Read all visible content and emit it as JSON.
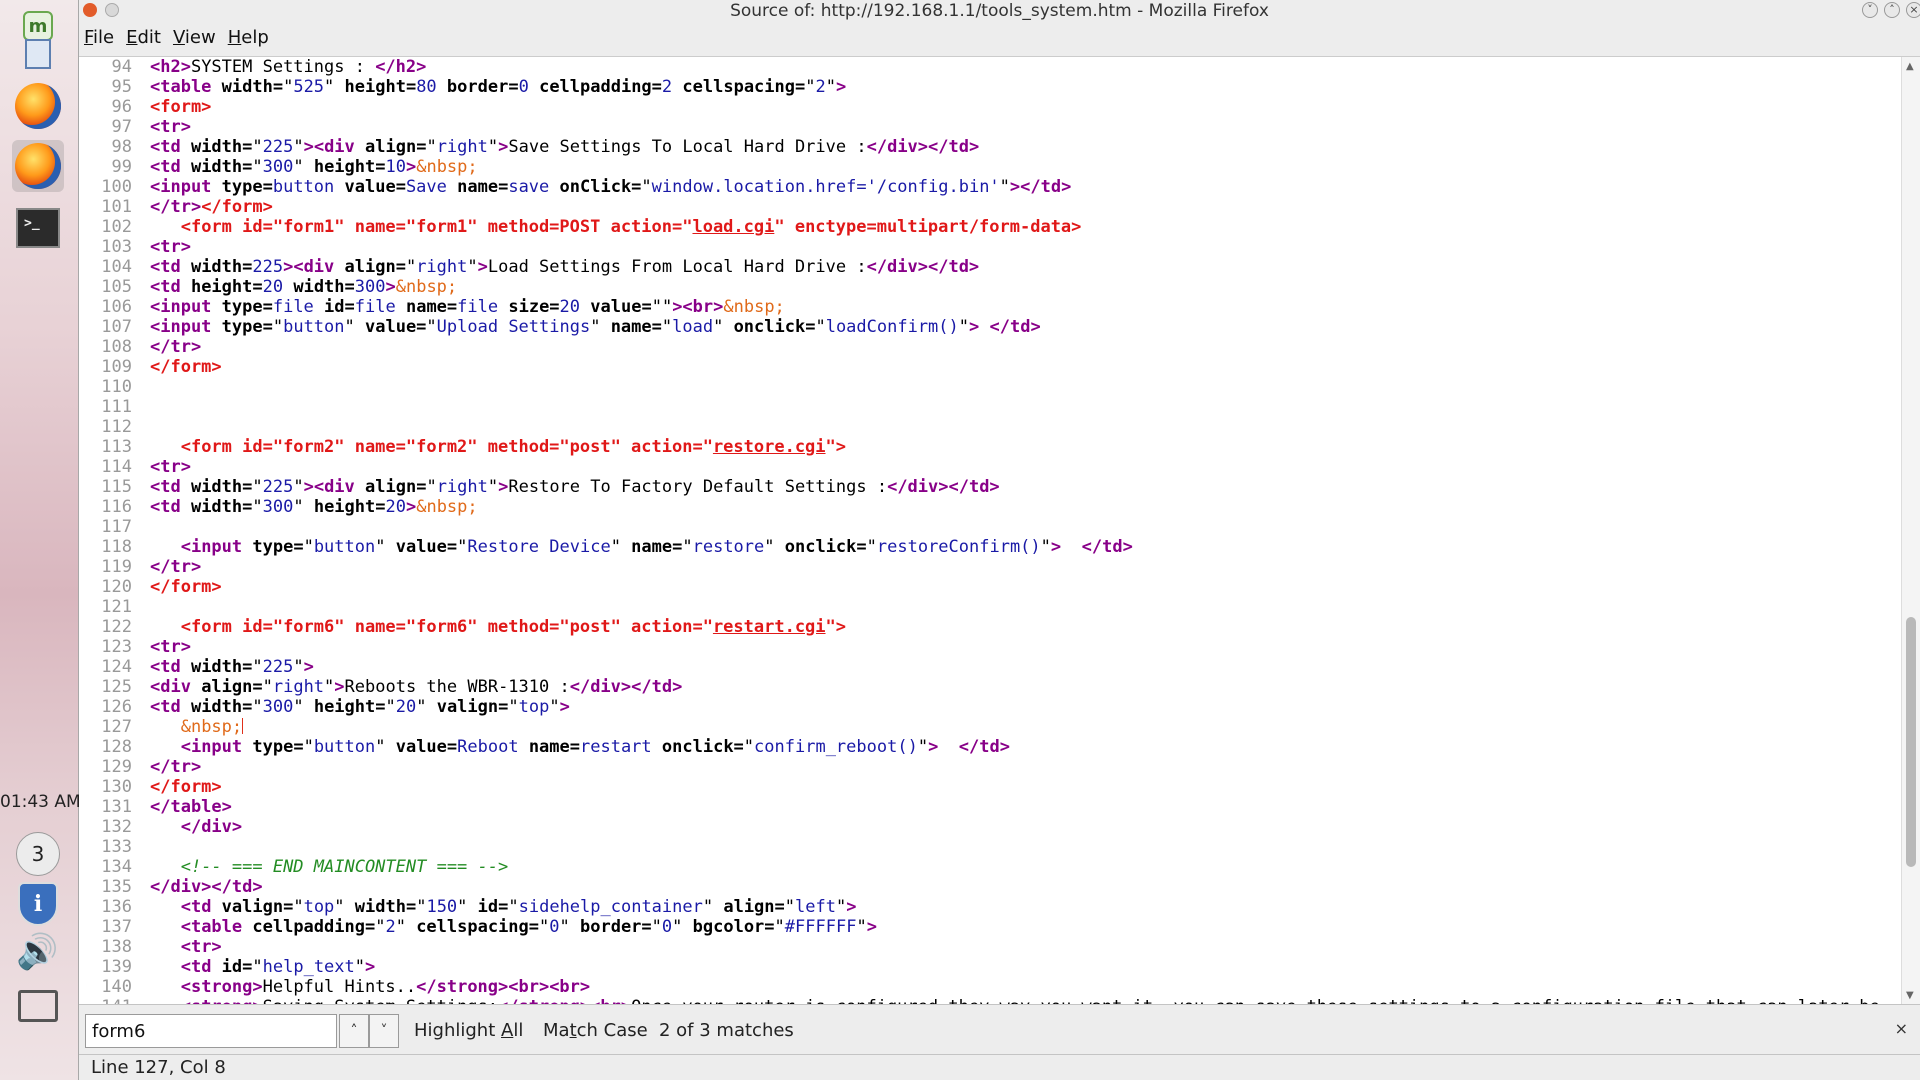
{
  "window": {
    "title": "Source of: http://192.168.1.1/tools_system.htm - Mozilla Firefox"
  },
  "menubar": {
    "items": [
      {
        "label": "File",
        "mnemonic": "F",
        "rest": "ile"
      },
      {
        "label": "Edit",
        "mnemonic": "E",
        "rest": "dit"
      },
      {
        "label": "View",
        "mnemonic": "V",
        "rest": "iew"
      },
      {
        "label": "Help",
        "mnemonic": "H",
        "rest": "elp"
      }
    ]
  },
  "dock": {
    "clock": "01:43 AM",
    "workspace": "3",
    "icons": [
      "mint-menu-icon",
      "file-manager-icon",
      "firefox-icon",
      "firefox-active-icon",
      "terminal-icon",
      "workspace-switcher",
      "update-manager-shield-icon",
      "volume-icon",
      "network-icon"
    ]
  },
  "source": {
    "lines": [
      {
        "n": "94",
        "html": "<span class=\"tag\">&lt;h2&gt;</span>SYSTEM Settings : <span class=\"tag\">&lt;/h2&gt;</span>"
      },
      {
        "n": "95",
        "html": "<span class=\"tag\">&lt;table </span><span class=\"attr\">width=</span>\"<span class=\"val\">525</span>\" <span class=\"attr\">height=</span><span class=\"val\">80</span> <span class=\"attr\">border=</span><span class=\"val\">0</span> <span class=\"attr\">cellpadding=</span><span class=\"val\">2</span> <span class=\"attr\">cellspacing=</span>\"<span class=\"val\">2</span>\"<span class=\"tag\">&gt;</span>"
      },
      {
        "n": "96",
        "html": "<span class=\"form\">&lt;form&gt;</span>"
      },
      {
        "n": "97",
        "html": "<span class=\"tag\">&lt;tr&gt;</span>"
      },
      {
        "n": "98",
        "html": "<span class=\"tag\">&lt;td </span><span class=\"attr\">width=</span>\"<span class=\"val\">225</span>\"<span class=\"tag\">&gt;&lt;div </span><span class=\"attr\">align=</span>\"<span class=\"val\">right</span>\"<span class=\"tag\">&gt;</span>Save Settings To Local Hard Drive :<span class=\"tag\">&lt;/div&gt;&lt;/td&gt;</span>"
      },
      {
        "n": "99",
        "html": "<span class=\"tag\">&lt;td </span><span class=\"attr\">width=</span>\"<span class=\"val\">300</span>\" <span class=\"attr\">height=</span><span class=\"val\">10</span><span class=\"tag\">&gt;</span><span class=\"ent\">&amp;nbsp;</span>"
      },
      {
        "n": "100",
        "html": "<span class=\"tag\">&lt;input </span><span class=\"attr\">type=</span><span class=\"val\">button</span> <span class=\"attr\">value=</span><span class=\"val\">Save</span> <span class=\"attr\">name=</span><span class=\"val\">save</span> <span class=\"attr\">onClick=</span>\"<span class=\"val\">window.location.href='/config.bin'</span>\"<span class=\"tag\">&gt;&lt;/td&gt;</span>"
      },
      {
        "n": "101",
        "html": "<span class=\"tag\">&lt;/tr&gt;</span><span class=\"form\">&lt;/form&gt;</span>"
      },
      {
        "n": "102",
        "html": "   <span class=\"form\">&lt;form id=\"form1\" name=\"form1\" method=POST action=\"</span><span class=\"formlink\">load.cgi</span><span class=\"form\">\" enctype=multipart/form-data&gt;</span>"
      },
      {
        "n": "103",
        "html": "<span class=\"tag\">&lt;tr&gt;</span>"
      },
      {
        "n": "104",
        "html": "<span class=\"tag\">&lt;td </span><span class=\"attr\">width=</span><span class=\"val\">225</span><span class=\"tag\">&gt;&lt;div </span><span class=\"attr\">align=</span>\"<span class=\"val\">right</span>\"<span class=\"tag\">&gt;</span>Load Settings From Local Hard Drive :<span class=\"tag\">&lt;/div&gt;&lt;/td&gt;</span>"
      },
      {
        "n": "105",
        "html": "<span class=\"tag\">&lt;td </span><span class=\"attr\">height=</span><span class=\"val\">20</span> <span class=\"attr\">width=</span><span class=\"val\">300</span><span class=\"tag\">&gt;</span><span class=\"ent\">&amp;nbsp;</span>"
      },
      {
        "n": "106",
        "html": "<span class=\"tag\">&lt;input </span><span class=\"attr\">type=</span><span class=\"val\">file</span> <span class=\"attr\">id=</span><span class=\"val\">file</span> <span class=\"attr\">name=</span><span class=\"val\">file</span> <span class=\"attr\">size=</span><span class=\"val\">20</span> <span class=\"attr\">value=</span>\"\"<span class=\"tag\">&gt;&lt;br&gt;</span><span class=\"ent\">&amp;nbsp;</span>"
      },
      {
        "n": "107",
        "html": "<span class=\"tag\">&lt;input </span><span class=\"attr\">type=</span>\"<span class=\"val\">button</span>\" <span class=\"attr\">value=</span>\"<span class=\"val\">Upload Settings</span>\" <span class=\"attr\">name=</span>\"<span class=\"val\">load</span>\" <span class=\"attr\">onclick=</span>\"<span class=\"val\">loadConfirm()</span>\"<span class=\"tag\">&gt;</span> <span class=\"tag\">&lt;/td&gt;</span>"
      },
      {
        "n": "108",
        "html": "<span class=\"tag\">&lt;/tr&gt;</span>"
      },
      {
        "n": "109",
        "html": "<span class=\"form\">&lt;/form&gt;</span>"
      },
      {
        "n": "110",
        "html": ""
      },
      {
        "n": "111",
        "html": ""
      },
      {
        "n": "112",
        "html": ""
      },
      {
        "n": "113",
        "html": "   <span class=\"form\">&lt;form id=\"form2\" name=\"form2\" method=\"post\" action=\"</span><span class=\"formlink\">restore.cgi</span><span class=\"form\">\"&gt;</span>"
      },
      {
        "n": "114",
        "html": "<span class=\"tag\">&lt;tr&gt;</span>"
      },
      {
        "n": "115",
        "html": "<span class=\"tag\">&lt;td </span><span class=\"attr\">width=</span>\"<span class=\"val\">225</span>\"<span class=\"tag\">&gt;&lt;div </span><span class=\"attr\">align=</span>\"<span class=\"val\">right</span>\"<span class=\"tag\">&gt;</span>Restore To Factory Default Settings :<span class=\"tag\">&lt;/div&gt;&lt;/td&gt;</span>"
      },
      {
        "n": "116",
        "html": "<span class=\"tag\">&lt;td </span><span class=\"attr\">width=</span>\"<span class=\"val\">300</span>\" <span class=\"attr\">height=</span><span class=\"val\">20</span><span class=\"tag\">&gt;</span><span class=\"ent\">&amp;nbsp;</span>"
      },
      {
        "n": "117",
        "html": ""
      },
      {
        "n": "118",
        "html": "   <span class=\"tag\">&lt;input </span><span class=\"attr\">type=</span>\"<span class=\"val\">button</span>\" <span class=\"attr\">value=</span>\"<span class=\"val\">Restore Device</span>\" <span class=\"attr\">name=</span>\"<span class=\"val\">restore</span>\" <span class=\"attr\">onclick=</span>\"<span class=\"val\">restoreConfirm()</span>\"<span class=\"tag\">&gt;</span>  <span class=\"tag\">&lt;/td&gt;</span>"
      },
      {
        "n": "119",
        "html": "<span class=\"tag\">&lt;/tr&gt;</span>"
      },
      {
        "n": "120",
        "html": "<span class=\"form\">&lt;/form&gt;</span>"
      },
      {
        "n": "121",
        "html": ""
      },
      {
        "n": "122",
        "html": "   <span class=\"form\">&lt;form id=\"form6\" name=\"form6\" method=\"post\" action=\"</span><span class=\"formlink\">restart.cgi</span><span class=\"form\">\"&gt;</span>"
      },
      {
        "n": "123",
        "html": "<span class=\"tag\">&lt;tr&gt;</span>"
      },
      {
        "n": "124",
        "html": "<span class=\"tag\">&lt;td </span><span class=\"attr\">width=</span>\"<span class=\"val\">225</span>\"<span class=\"tag\">&gt;</span>"
      },
      {
        "n": "125",
        "html": "<span class=\"tag\">&lt;div </span><span class=\"attr\">align=</span>\"<span class=\"val\">right</span>\"<span class=\"tag\">&gt;</span>Reboots the WBR-1310 :<span class=\"tag\">&lt;/div&gt;&lt;/td&gt;</span>"
      },
      {
        "n": "126",
        "html": "<span class=\"tag\">&lt;td </span><span class=\"attr\">width=</span>\"<span class=\"val\">300</span>\" <span class=\"attr\">height=</span>\"<span class=\"val\">20</span>\" <span class=\"attr\">valign=</span>\"<span class=\"val\">top</span>\"<span class=\"tag\">&gt;</span>"
      },
      {
        "n": "127",
        "html": "   <span class=\"ent\">&amp;nbsp;</span><span class=\"caret\"></span>"
      },
      {
        "n": "128",
        "html": "   <span class=\"tag\">&lt;input </span><span class=\"attr\">type=</span>\"<span class=\"val\">button</span>\" <span class=\"attr\">value=</span><span class=\"val\">Reboot</span> <span class=\"attr\">name=</span><span class=\"val\">restart</span> <span class=\"attr\">onclick=</span>\"<span class=\"val\">confirm_reboot()</span>\"<span class=\"tag\">&gt;</span>  <span class=\"tag\">&lt;/td&gt;</span>"
      },
      {
        "n": "129",
        "html": "<span class=\"tag\">&lt;/tr&gt;</span>"
      },
      {
        "n": "130",
        "html": "<span class=\"form\">&lt;/form&gt;</span>"
      },
      {
        "n": "131",
        "html": "<span class=\"tag\">&lt;/table&gt;</span>"
      },
      {
        "n": "132",
        "html": "   <span class=\"tag\">&lt;/div&gt;</span>"
      },
      {
        "n": "133",
        "html": ""
      },
      {
        "n": "134",
        "html": "   <span class=\"cmt\">&lt;!-- === END MAINCONTENT === --&gt;</span>"
      },
      {
        "n": "135",
        "html": "<span class=\"tag\">&lt;/div&gt;&lt;/td&gt;</span>"
      },
      {
        "n": "136",
        "html": "   <span class=\"tag\">&lt;td </span><span class=\"attr\">valign=</span>\"<span class=\"val\">top</span>\" <span class=\"attr\">width=</span>\"<span class=\"val\">150</span>\" <span class=\"attr\">id=</span>\"<span class=\"val\">sidehelp_container</span>\" <span class=\"attr\">align=</span>\"<span class=\"val\">left</span>\"<span class=\"tag\">&gt;</span>"
      },
      {
        "n": "137",
        "html": "   <span class=\"tag\">&lt;table </span><span class=\"attr\">cellpadding=</span>\"<span class=\"val\">2</span>\" <span class=\"attr\">cellspacing=</span>\"<span class=\"val\">0</span>\" <span class=\"attr\">border=</span>\"<span class=\"val\">0</span>\" <span class=\"attr\">bgcolor=</span>\"<span class=\"val\">#FFFFFF</span>\"<span class=\"tag\">&gt;</span>"
      },
      {
        "n": "138",
        "html": "   <span class=\"tag\">&lt;tr&gt;</span>"
      },
      {
        "n": "139",
        "html": "   <span class=\"tag\">&lt;td </span><span class=\"attr\">id=</span>\"<span class=\"val\">help_text</span>\"<span class=\"tag\">&gt;</span>"
      },
      {
        "n": "140",
        "html": "   <span class=\"tag\">&lt;strong&gt;</span>Helpful Hints..<span class=\"tag\">&lt;/strong&gt;&lt;br&gt;&lt;br&gt;</span>"
      },
      {
        "n": "141",
        "html": "   <span class=\"tag\">&lt;strong&gt;</span>Saving System Settings:<span class=\"tag\">&lt;/strong&gt;&lt;br&gt;</span>Once your router is configured they way you want it, you can save these settings to a configuration file that can later be"
      }
    ]
  },
  "findbar": {
    "query": "form6",
    "prev_label": "˄",
    "next_label": "˅",
    "highlight_all": {
      "label": "Highlight All",
      "mnemonic": "A",
      "before": "Highlight ",
      "after": "ll"
    },
    "match_case": {
      "label": "Match Case",
      "mnemonic": "t",
      "before": "Ma",
      "after": "ch Case"
    },
    "status": "2 of 3 matches",
    "close": "×"
  },
  "statusbar": {
    "text": "Line 127, Col 8"
  },
  "colors": {
    "tag": "#880088",
    "value": "#1a1aa6",
    "entity": "#e06a1a",
    "form": "#e01818",
    "comment": "#238c23"
  }
}
